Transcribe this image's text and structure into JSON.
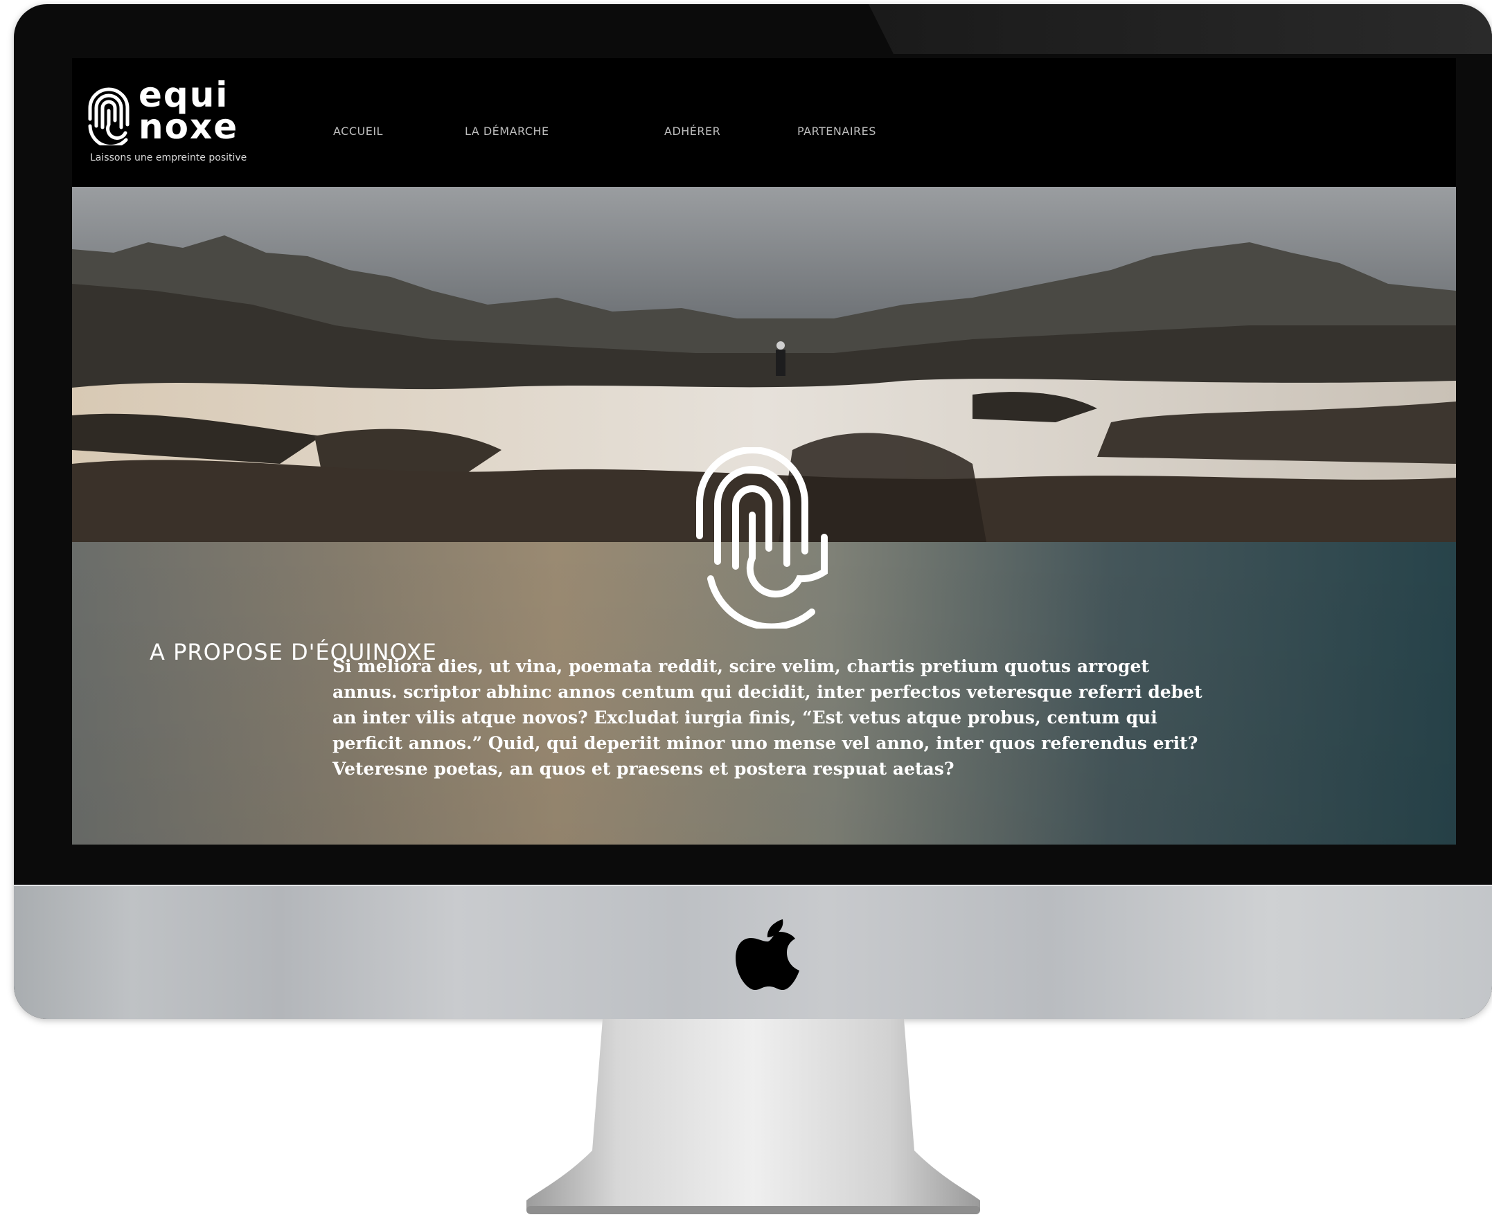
{
  "site": {
    "logo_line1": "equi",
    "logo_line2": "noxe",
    "tagline": "Laissons une empreinte positive"
  },
  "nav": {
    "items": [
      {
        "label": "ACCUEIL"
      },
      {
        "label": "LA DÉMARCHE"
      },
      {
        "label": "ADHÉRER"
      },
      {
        "label": "PARTENAIRES"
      }
    ]
  },
  "about": {
    "title": "A PROPOSE D'ÉQUINOXE",
    "text": "Si meliora dies, ut vina, poemata reddit, scire velim, chartis pretium quotus arroget annus. scriptor abhinc annos centum qui decidit, inter perfectos veteresque referri debet an inter vilis atque novos? Excludat iurgia finis, “Est vetus atque probus, centum qui perficit annos.” Quid, qui deperiit minor uno mense vel anno, inter quos referendus erit? Veteresne poetas, an quos et praesens et postera respuat aetas?"
  },
  "colors": {
    "background": "#000000",
    "text": "#ffffff",
    "nav_text": "#bdbdbd",
    "teal": "#27434a",
    "sand": "#9a8a72"
  },
  "icons": {
    "brand": "fingerprint-icon",
    "device": "apple-logo-icon"
  }
}
